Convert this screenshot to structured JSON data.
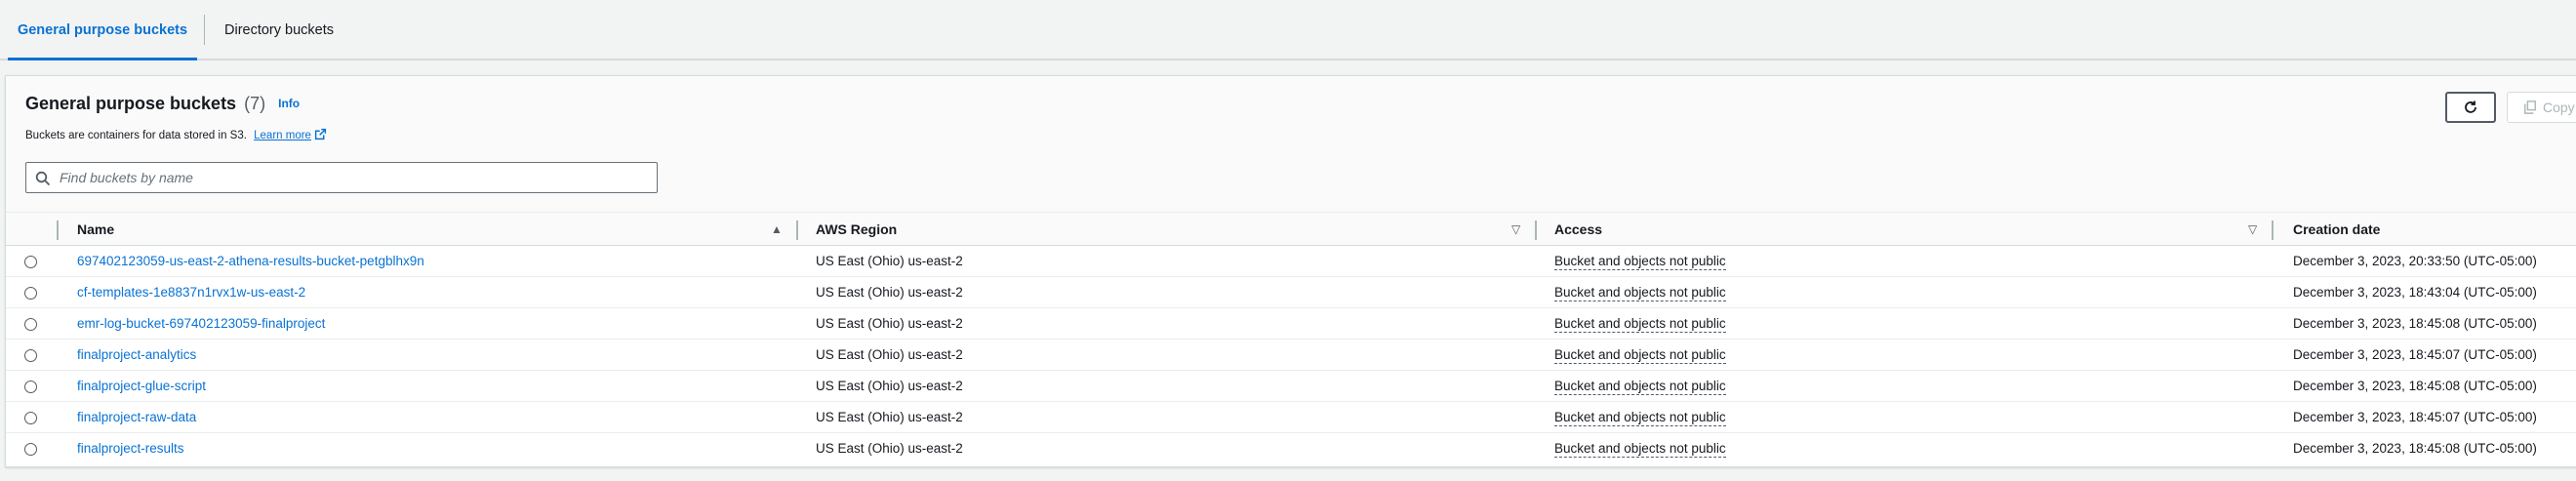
{
  "tabs": [
    {
      "label": "General purpose buckets",
      "active": true
    },
    {
      "label": "Directory buckets",
      "active": false
    }
  ],
  "panel": {
    "title": "General purpose buckets",
    "count": "(7)",
    "info": "Info",
    "description": "Buckets are containers for data stored in S3.",
    "learn_more": "Learn more",
    "refresh_icon": "refresh-icon",
    "copy_label": "Copy",
    "copy_icon": "copy-icon"
  },
  "search": {
    "placeholder": "Find buckets by name",
    "value": ""
  },
  "table": {
    "columns": {
      "name": "Name",
      "region": "AWS Region",
      "access": "Access",
      "created": "Creation date"
    },
    "rows": [
      {
        "name": "697402123059-us-east-2-athena-results-bucket-petgblhx9n",
        "region": "US East (Ohio) us-east-2",
        "access": "Bucket and objects not public",
        "created": "December 3, 2023, 20:33:50 (UTC-05:00)"
      },
      {
        "name": "cf-templates-1e8837n1rvx1w-us-east-2",
        "region": "US East (Ohio) us-east-2",
        "access": "Bucket and objects not public",
        "created": "December 3, 2023, 18:43:04 (UTC-05:00)"
      },
      {
        "name": "emr-log-bucket-697402123059-finalproject",
        "region": "US East (Ohio) us-east-2",
        "access": "Bucket and objects not public",
        "created": "December 3, 2023, 18:45:08 (UTC-05:00)"
      },
      {
        "name": "finalproject-analytics",
        "region": "US East (Ohio) us-east-2",
        "access": "Bucket and objects not public",
        "created": "December 3, 2023, 18:45:07 (UTC-05:00)"
      },
      {
        "name": "finalproject-glue-script",
        "region": "US East (Ohio) us-east-2",
        "access": "Bucket and objects not public",
        "created": "December 3, 2023, 18:45:08 (UTC-05:00)"
      },
      {
        "name": "finalproject-raw-data",
        "region": "US East (Ohio) us-east-2",
        "access": "Bucket and objects not public",
        "created": "December 3, 2023, 18:45:07 (UTC-05:00)"
      },
      {
        "name": "finalproject-results",
        "region": "US East (Ohio) us-east-2",
        "access": "Bucket and objects not public",
        "created": "December 3, 2023, 18:45:08 (UTC-05:00)"
      }
    ]
  },
  "colors": {
    "accent": "#0972d3",
    "text": "#16191f",
    "muted": "#545b64"
  }
}
